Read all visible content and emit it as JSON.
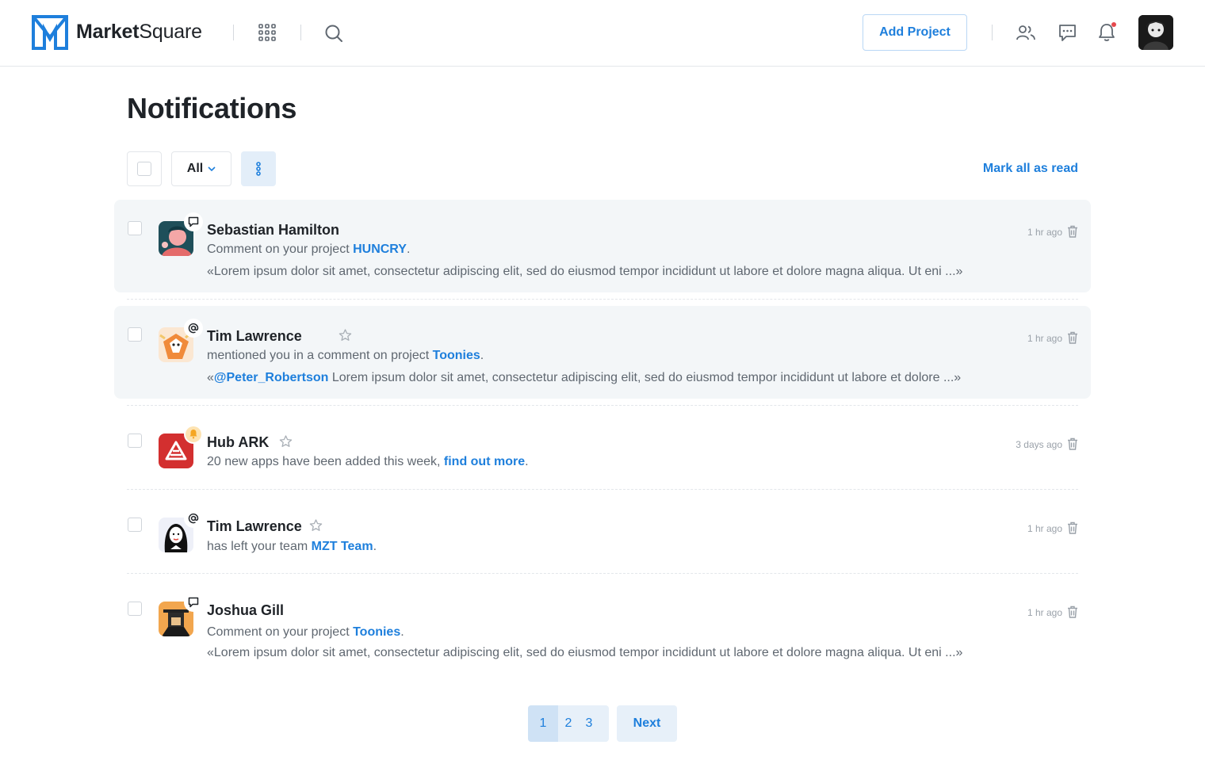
{
  "header": {
    "brand_bold": "Market",
    "brand_light": "Square",
    "add_project_label": "Add Project"
  },
  "page": {
    "title": "Notifications"
  },
  "toolbar": {
    "filter_label": "All",
    "mark_all_label": "Mark all as read"
  },
  "notifications": [
    {
      "name": "Sebastian Hamilton",
      "badge_icon": "comment-icon",
      "action_text": "Comment on your project ",
      "link_text": "HUNCRY",
      "suffix": ".",
      "quote": "«Lorem ipsum dolor sit amet, consectetur adipiscing elit, sed do eiusmod tempor incididunt ut labore et dolore magna aliqua. Ut eni ...»",
      "time": "1 hr ago",
      "unread": true
    },
    {
      "name": "Tim Lawrence",
      "badge_icon": "mention-icon",
      "action_text": "mentioned you in a comment on project ",
      "link_text": "Toonies",
      "suffix": ".",
      "quote_prefix": "«",
      "quote_mention": "@Peter_Robertson",
      "quote": " Lorem ipsum dolor sit amet, consectetur adipiscing elit, sed do eiusmod tempor incididunt ut labore et dolore  ...»",
      "time": "1 hr ago",
      "unread": true
    },
    {
      "name": "Hub ARK",
      "badge_icon": "bell-icon",
      "action_text": "20 new apps have been added this week, ",
      "link_text": "find out more",
      "suffix": ".",
      "time": "3 days ago",
      "unread": false
    },
    {
      "name": "Tim Lawrence",
      "badge_icon": "mention-icon",
      "action_text": "has left your team ",
      "link_text": "MZT Team",
      "suffix": ".",
      "time": "1 hr ago",
      "unread": false
    },
    {
      "name": "Joshua Gill",
      "badge_icon": "comment-icon",
      "action_text": "Comment on your project ",
      "link_text": "Toonies",
      "suffix": ".",
      "quote": "«Lorem ipsum dolor sit amet, consectetur adipiscing elit, sed do eiusmod tempor incididunt ut labore et dolore magna aliqua. Ut eni ...»",
      "time": "1 hr ago",
      "unread": false
    }
  ],
  "pagination": {
    "pages": [
      "1",
      "2",
      "3"
    ],
    "current": "1",
    "next_label": "Next"
  },
  "colors": {
    "accent": "#1e7fdc",
    "unread_bg": "#f3f6f8",
    "notify_dot": "#e5484d",
    "bell_badge": "#f5a623",
    "hub_ark_red": "#d32f2f"
  }
}
